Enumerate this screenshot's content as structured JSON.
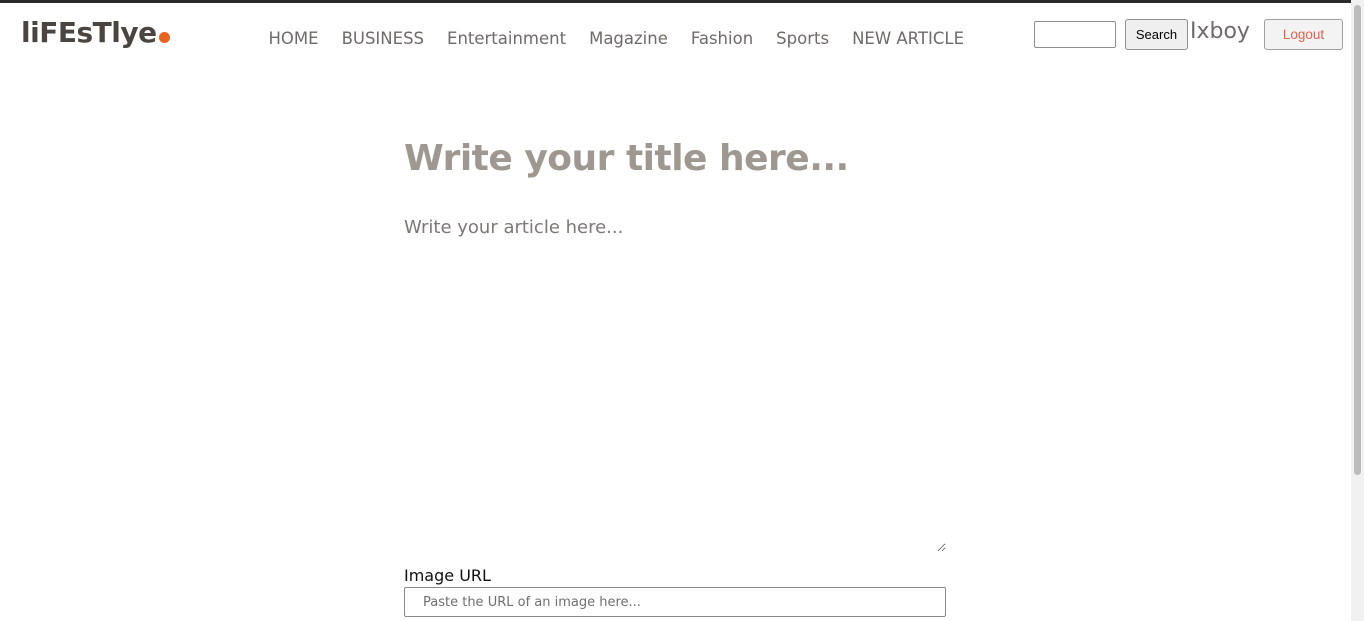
{
  "brand": {
    "logo_text": "liFEsTlye",
    "accent_color": "#e8641b"
  },
  "nav": {
    "items": [
      {
        "label": "HOME"
      },
      {
        "label": "BUSINESS"
      },
      {
        "label": "Entertainment"
      },
      {
        "label": "Magazine"
      },
      {
        "label": "Fashion"
      },
      {
        "label": "Sports"
      },
      {
        "label": "NEW ARTICLE"
      }
    ]
  },
  "header": {
    "search_value": "",
    "search_button": "Search",
    "username": "Ixboy",
    "logout_button": "Logout"
  },
  "editor": {
    "title_placeholder": "Write your title here...",
    "article_placeholder": "Write your article here...",
    "image_url_label": "Image URL",
    "image_url_placeholder": "Paste the URL of an image here..."
  }
}
